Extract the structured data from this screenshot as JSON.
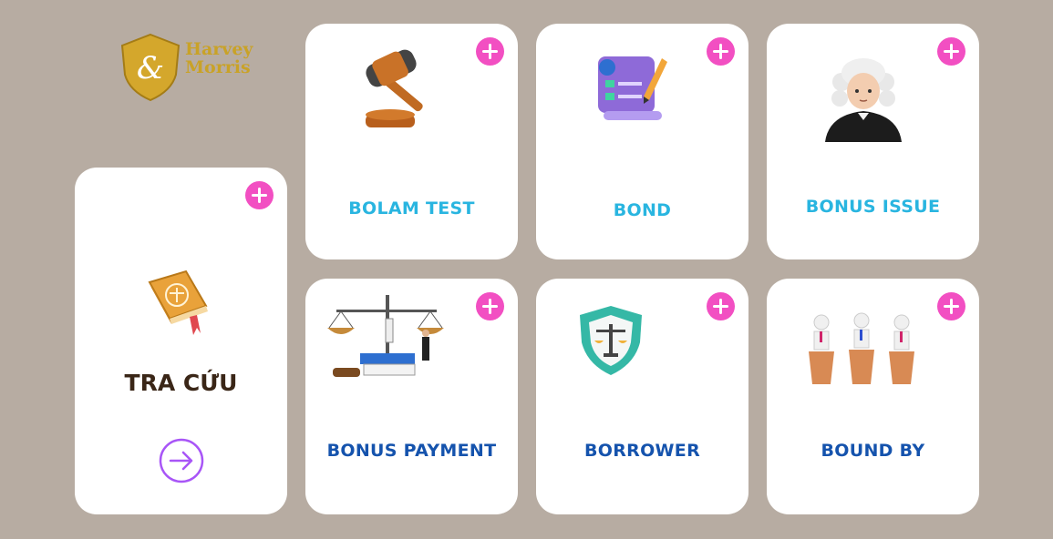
{
  "logo": {
    "line1": "Harvey",
    "line2": "Morris",
    "mark": "&"
  },
  "lookup_card": {
    "title": "TRA CỨU",
    "icon": "law-book-icon",
    "action_icon": "arrow-right-circle-icon"
  },
  "cards": [
    {
      "title": "BOLAM TEST",
      "icon": "gavel-icon"
    },
    {
      "title": "BOND",
      "icon": "contract-document-icon"
    },
    {
      "title": "BONUS ISSUE",
      "icon": "judge-icon"
    },
    {
      "title": "BONUS PAYMENT",
      "icon": "scales-of-justice-icon"
    },
    {
      "title": "BORROWER",
      "icon": "shield-scales-icon"
    },
    {
      "title": "BOUND BY",
      "icon": "courtroom-figures-icon"
    }
  ],
  "colors": {
    "background": "#b7aca2",
    "plus": "#f24fc2",
    "title_cyan": "#29b5e0",
    "title_blue": "#1553ad",
    "main_title": "#3a2617",
    "arrow": "#a855f7",
    "logo_gold": "#c9a227"
  }
}
